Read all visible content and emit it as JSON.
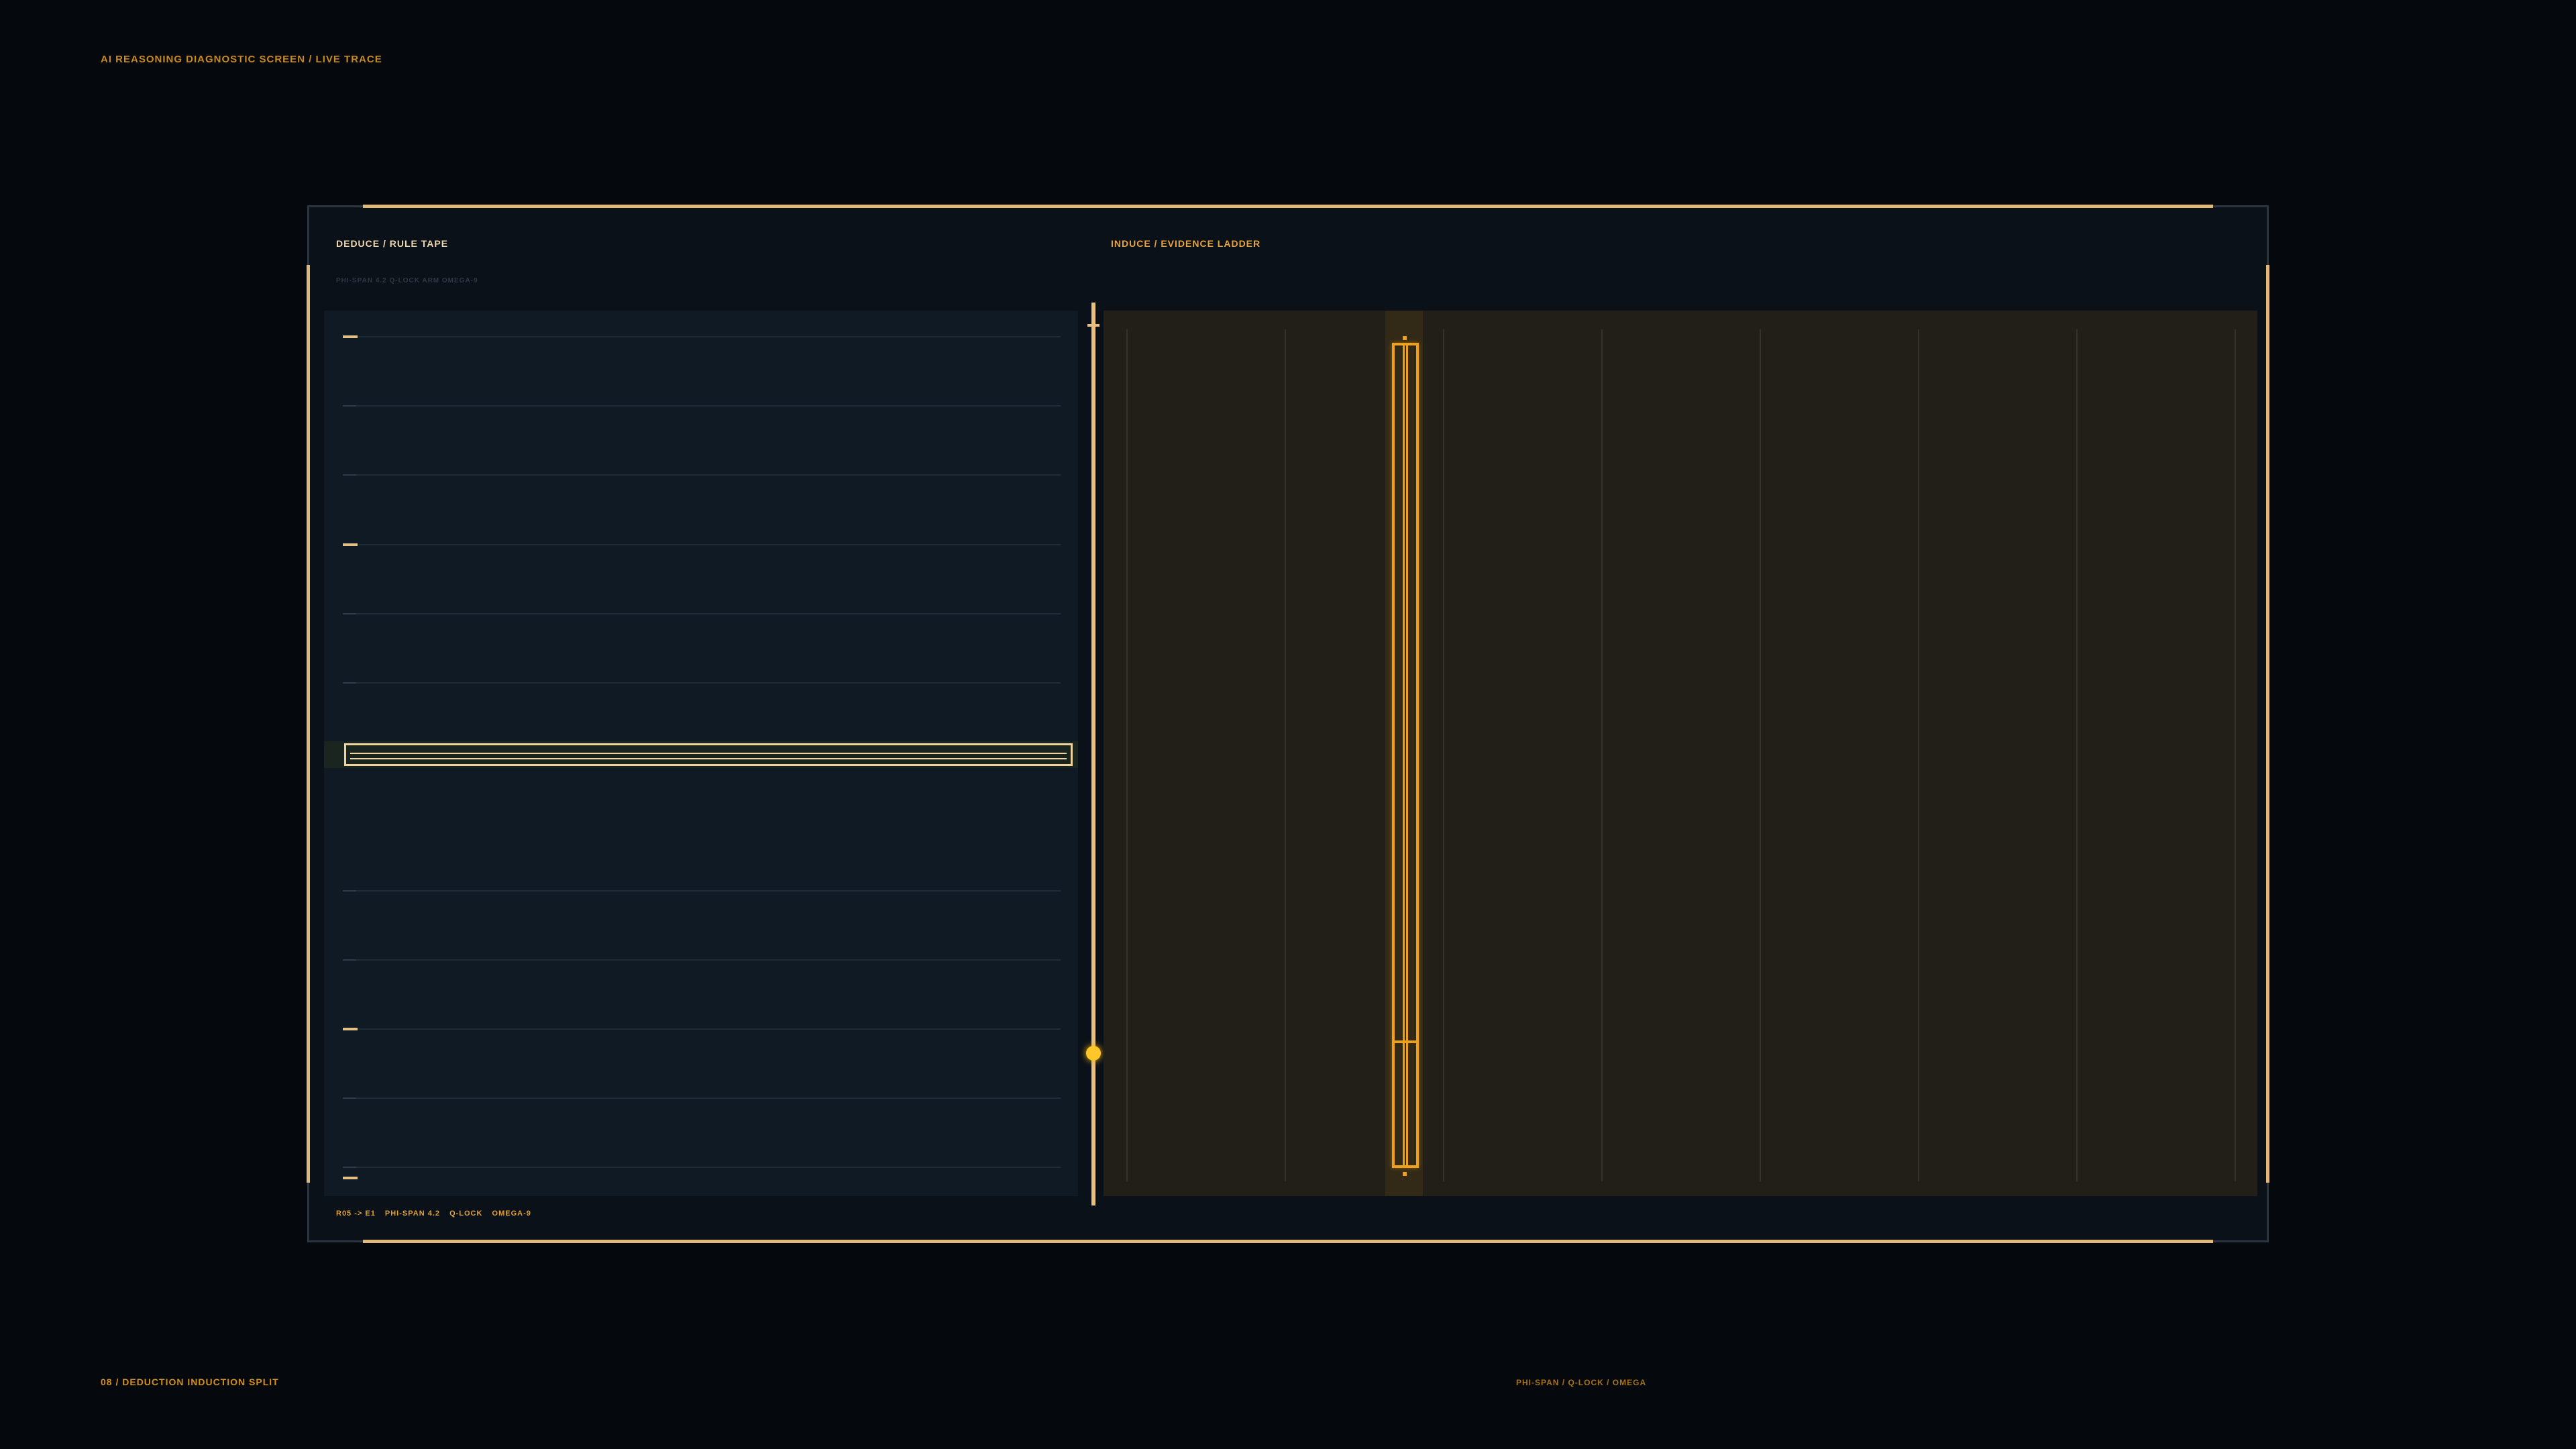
{
  "screen": {
    "top_label": "AI REASONING DIAGNOSTIC SCREEN  /  LIVE TRACE",
    "footer_left": "08 / DEDUCTION INDUCTION SPLIT",
    "footer_center": "PHI-SPAN  /  Q-LOCK  /  OMEGA"
  },
  "deduce": {
    "title": "DEDUCE  /  RULE TAPE",
    "meta": "PHI-SPAN 4.2   Q-LOCK ARM   OMEGA-9"
  },
  "induce": {
    "title": "INDUCE  /  EVIDENCE LADDER"
  },
  "status": {
    "items": [
      "R05 -> E1",
      "PHI-SPAN 4.2",
      "Q-LOCK",
      "OMEGA-9"
    ]
  },
  "colors": {
    "accent": "#e8c07a",
    "amber": "#f0a018",
    "marker": "#ffc629",
    "background": "#05080c"
  }
}
